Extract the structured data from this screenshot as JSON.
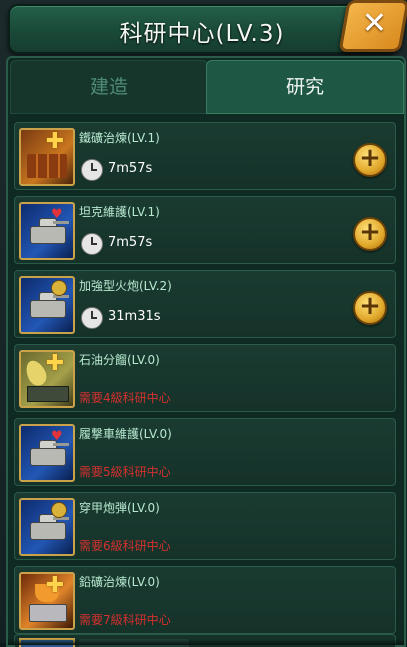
{
  "window": {
    "title": "科研中心(LV.3)",
    "close_icon": "close-x-icon"
  },
  "tabs": [
    {
      "label": "建造",
      "active": false
    },
    {
      "label": "研究",
      "active": true
    }
  ],
  "research_items": [
    {
      "name": "鐵礦治煉(LV.1)",
      "icon": "copper-smelting-icon",
      "status": "timer",
      "time": "7m57s",
      "action": "add-icon"
    },
    {
      "name": "坦克維護(LV.1)",
      "icon": "tank-repair-icon",
      "status": "timer",
      "time": "7m57s",
      "action": "add-icon"
    },
    {
      "name": "加強型火炮(LV.2)",
      "icon": "tank-artillery-icon",
      "status": "timer",
      "time": "31m31s",
      "action": "add-icon"
    },
    {
      "name": "石油分餾(LV.0)",
      "icon": "oil-fractionation-icon",
      "status": "locked",
      "requirement": "需要4級科研中心"
    },
    {
      "name": "履撃車維護(LV.0)",
      "icon": "tracked-vehicle-repair-icon",
      "status": "locked",
      "requirement": "需要5級科研中心"
    },
    {
      "name": "穿甲炮弾(LV.0)",
      "icon": "armor-piercing-shell-icon",
      "status": "locked",
      "requirement": "需要6級科研中心"
    },
    {
      "name": "鉛礦治煉(LV.0)",
      "icon": "lead-smelting-icon",
      "status": "locked",
      "requirement": "需要7級科研中心"
    }
  ],
  "colors": {
    "title_bar": "#1f5a44",
    "active_tab": "#1e5844",
    "inactive_tab_text": "#4f8c76",
    "item_name": "#b7e9cf",
    "requirement_text": "#d4302e",
    "action_button": "#e0a82a"
  }
}
